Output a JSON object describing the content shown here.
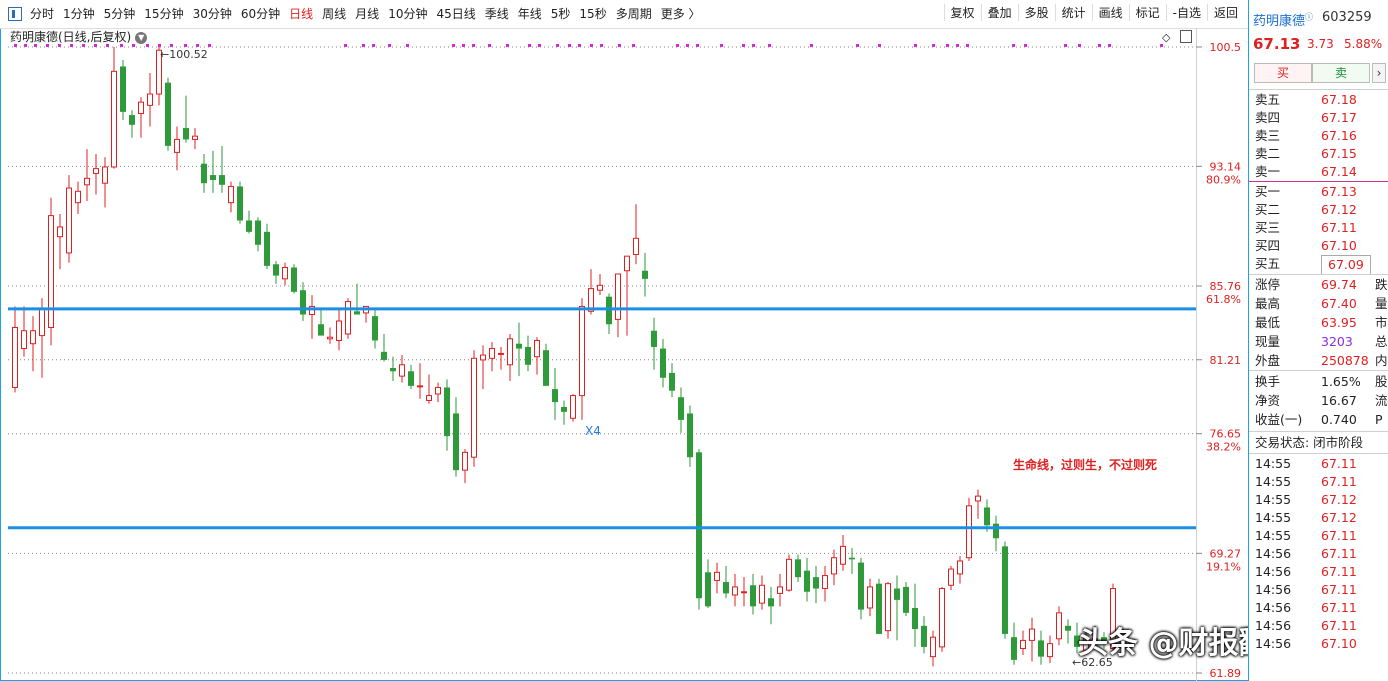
{
  "toolbar": {
    "periods": [
      "分时",
      "1分钟",
      "5分钟",
      "15分钟",
      "30分钟",
      "60分钟",
      "日线",
      "周线",
      "月线",
      "10分钟",
      "45日线",
      "季线",
      "年线",
      "5秒",
      "15秒",
      "多周期",
      "更多 〉"
    ],
    "active_period": "日线",
    "tools": [
      "复权",
      "叠加",
      "多股",
      "统计",
      "画线",
      "标记",
      "-自选",
      "返回"
    ]
  },
  "chart": {
    "title": "药明康德(日线,后复权)",
    "high_label": "100.52",
    "low_label": "62.65",
    "annotation": "生命线，过则生，不过则死",
    "marker_x4": "X4",
    "price_axis": [
      {
        "price": 100.5,
        "label": "100.5",
        "pct": ""
      },
      {
        "price": 93.14,
        "label": "93.14",
        "pct": "80.9%"
      },
      {
        "price": 85.76,
        "label": "85.76",
        "pct": "61.8%"
      },
      {
        "price": 81.21,
        "label": "81.21",
        "pct": ""
      },
      {
        "price": 76.65,
        "label": "76.65",
        "pct": "38.2%"
      },
      {
        "price": 69.27,
        "label": "69.27",
        "pct": "19.1%"
      },
      {
        "price": 61.89,
        "label": "61.89",
        "pct": ""
      }
    ],
    "support_lines": [
      84.35,
      70.85
    ],
    "colors": {
      "up": "#e02020",
      "down": "#2e9a3a",
      "line": "#1a8fe3",
      "dots": "#e020e0"
    }
  },
  "watermark": "头条 @财报翻译官",
  "quote": {
    "name": "药明康德",
    "code": "603259",
    "price": "67.13",
    "change": "3.73",
    "pct": "5.88%",
    "buy": "买",
    "sell": "卖",
    "asks": [
      {
        "label": "卖五",
        "price": "67.18"
      },
      {
        "label": "卖四",
        "price": "67.17"
      },
      {
        "label": "卖三",
        "price": "67.16"
      },
      {
        "label": "卖二",
        "price": "67.15"
      },
      {
        "label": "卖一",
        "price": "67.14"
      }
    ],
    "bids": [
      {
        "label": "买一",
        "price": "67.13"
      },
      {
        "label": "买二",
        "price": "67.12"
      },
      {
        "label": "买三",
        "price": "67.11"
      },
      {
        "label": "买四",
        "price": "67.10"
      },
      {
        "label": "买五",
        "price": "67.09"
      }
    ],
    "stats1": [
      {
        "label": "涨停",
        "value": "69.74",
        "cls": "red",
        "right": "跌"
      },
      {
        "label": "最高",
        "value": "67.40",
        "cls": "red",
        "right": "量"
      },
      {
        "label": "最低",
        "value": "63.95",
        "cls": "red",
        "right": "市"
      },
      {
        "label": "现量",
        "value": "3203",
        "cls": "purple",
        "right": "总"
      },
      {
        "label": "外盘",
        "value": "250878",
        "cls": "red",
        "right": "内"
      }
    ],
    "stats2": [
      {
        "label": "换手",
        "value": "1.65%",
        "right": "股"
      },
      {
        "label": "净资",
        "value": "16.67",
        "right": "流"
      },
      {
        "label": "收益(一)",
        "value": "0.740",
        "right": "P"
      }
    ],
    "status_label": "交易状态: 闭市阶段",
    "ticks": [
      {
        "t": "14:55",
        "p": "67.11"
      },
      {
        "t": "14:55",
        "p": "67.11"
      },
      {
        "t": "14:55",
        "p": "67.12"
      },
      {
        "t": "14:55",
        "p": "67.12"
      },
      {
        "t": "14:55",
        "p": "67.11"
      },
      {
        "t": "14:56",
        "p": "67.11"
      },
      {
        "t": "14:56",
        "p": "67.11"
      },
      {
        "t": "14:56",
        "p": "67.11"
      },
      {
        "t": "14:56",
        "p": "67.11"
      },
      {
        "t": "14:56",
        "p": "67.11"
      },
      {
        "t": "14:56",
        "p": "67.10"
      }
    ]
  },
  "candles": [
    {
      "o": 79.5,
      "h": 84.5,
      "l": 79.2,
      "c": 83.2
    },
    {
      "o": 81.9,
      "h": 84.5,
      "l": 81.4,
      "c": 83.0
    },
    {
      "o": 82.2,
      "h": 83.9,
      "l": 80.5,
      "c": 83.0
    },
    {
      "o": 82.7,
      "h": 85.0,
      "l": 80.1,
      "c": 84.4
    },
    {
      "o": 83.2,
      "h": 91.2,
      "l": 82.1,
      "c": 90.1
    },
    {
      "o": 88.8,
      "h": 90.2,
      "l": 86.8,
      "c": 89.4
    },
    {
      "o": 87.8,
      "h": 92.6,
      "l": 87.2,
      "c": 91.8
    },
    {
      "o": 90.9,
      "h": 92.2,
      "l": 90.2,
      "c": 91.6
    },
    {
      "o": 92.0,
      "h": 94.2,
      "l": 91.0,
      "c": 92.4
    },
    {
      "o": 92.7,
      "h": 93.9,
      "l": 91.4,
      "c": 93.0
    },
    {
      "o": 92.1,
      "h": 93.7,
      "l": 90.6,
      "c": 93.1
    },
    {
      "o": 93.1,
      "h": 100.5,
      "l": 93.0,
      "c": 99.0
    },
    {
      "o": 99.3,
      "h": 99.7,
      "l": 96.0,
      "c": 96.5
    },
    {
      "o": 96.3,
      "h": 96.6,
      "l": 94.9,
      "c": 95.7
    },
    {
      "o": 96.4,
      "h": 97.4,
      "l": 94.9,
      "c": 97.1
    },
    {
      "o": 96.9,
      "h": 98.9,
      "l": 95.6,
      "c": 97.6
    },
    {
      "o": 97.6,
      "h": 100.5,
      "l": 96.9,
      "c": 100.3
    },
    {
      "o": 98.3,
      "h": 98.6,
      "l": 94.1,
      "c": 94.4
    },
    {
      "o": 94.0,
      "h": 95.6,
      "l": 92.9,
      "c": 94.8
    },
    {
      "o": 95.5,
      "h": 97.5,
      "l": 94.6,
      "c": 94.8
    },
    {
      "o": 94.8,
      "h": 95.5,
      "l": 94.2,
      "c": 95.0
    },
    {
      "o": 93.3,
      "h": 93.9,
      "l": 91.5,
      "c": 92.1
    },
    {
      "o": 92.6,
      "h": 94.1,
      "l": 91.5,
      "c": 92.3
    },
    {
      "o": 92.6,
      "h": 94.4,
      "l": 91.5,
      "c": 92.0
    },
    {
      "o": 90.9,
      "h": 92.2,
      "l": 90.3,
      "c": 91.9
    },
    {
      "o": 91.9,
      "h": 92.2,
      "l": 89.6,
      "c": 89.8
    },
    {
      "o": 89.8,
      "h": 90.4,
      "l": 89.0,
      "c": 89.1
    },
    {
      "o": 89.8,
      "h": 90.0,
      "l": 87.9,
      "c": 88.3
    },
    {
      "o": 89.1,
      "h": 89.6,
      "l": 86.8,
      "c": 87.0
    },
    {
      "o": 87.1,
      "h": 87.3,
      "l": 85.9,
      "c": 86.4
    },
    {
      "o": 86.2,
      "h": 87.2,
      "l": 85.8,
      "c": 86.9
    },
    {
      "o": 86.9,
      "h": 87.1,
      "l": 85.3,
      "c": 85.4
    },
    {
      "o": 85.5,
      "h": 86.0,
      "l": 83.6,
      "c": 84.0
    },
    {
      "o": 84.0,
      "h": 85.2,
      "l": 82.5,
      "c": 84.5
    },
    {
      "o": 83.4,
      "h": 84.4,
      "l": 82.9,
      "c": 82.7
    },
    {
      "o": 82.5,
      "h": 83.2,
      "l": 82.2,
      "c": 82.6
    },
    {
      "o": 82.4,
      "h": 84.3,
      "l": 81.8,
      "c": 83.6
    },
    {
      "o": 82.8,
      "h": 85.0,
      "l": 82.5,
      "c": 84.8
    },
    {
      "o": 84.2,
      "h": 85.9,
      "l": 84.0,
      "c": 84.0
    },
    {
      "o": 84.1,
      "h": 84.5,
      "l": 83.5,
      "c": 84.5
    },
    {
      "o": 83.9,
      "h": 84.3,
      "l": 81.9,
      "c": 82.4
    },
    {
      "o": 81.7,
      "h": 82.8,
      "l": 81.1,
      "c": 81.2
    },
    {
      "o": 80.7,
      "h": 81.4,
      "l": 79.9,
      "c": 80.5
    },
    {
      "o": 80.2,
      "h": 81.5,
      "l": 79.8,
      "c": 80.9
    },
    {
      "o": 80.5,
      "h": 80.9,
      "l": 79.4,
      "c": 79.6
    },
    {
      "o": 79.6,
      "h": 81.0,
      "l": 78.8,
      "c": 79.6
    },
    {
      "o": 78.7,
      "h": 80.3,
      "l": 78.5,
      "c": 79.0
    },
    {
      "o": 79.1,
      "h": 79.8,
      "l": 78.6,
      "c": 79.5
    },
    {
      "o": 79.5,
      "h": 80.0,
      "l": 75.6,
      "c": 76.5
    },
    {
      "o": 77.9,
      "h": 78.9,
      "l": 74.0,
      "c": 74.4
    },
    {
      "o": 74.4,
      "h": 75.7,
      "l": 73.6,
      "c": 75.5
    },
    {
      "o": 75.2,
      "h": 81.8,
      "l": 74.6,
      "c": 81.3
    },
    {
      "o": 81.2,
      "h": 82.1,
      "l": 79.4,
      "c": 81.5
    },
    {
      "o": 81.3,
      "h": 82.3,
      "l": 80.5,
      "c": 81.9
    },
    {
      "o": 81.6,
      "h": 82.0,
      "l": 80.6,
      "c": 81.6
    },
    {
      "o": 80.9,
      "h": 82.8,
      "l": 79.9,
      "c": 82.5
    },
    {
      "o": 82.2,
      "h": 83.5,
      "l": 80.2,
      "c": 81.9
    },
    {
      "o": 82.0,
      "h": 82.7,
      "l": 80.5,
      "c": 80.9
    },
    {
      "o": 81.4,
      "h": 82.6,
      "l": 80.3,
      "c": 82.4
    },
    {
      "o": 81.8,
      "h": 82.2,
      "l": 80.4,
      "c": 79.6
    },
    {
      "o": 79.4,
      "h": 80.7,
      "l": 77.5,
      "c": 78.6
    },
    {
      "o": 78.3,
      "h": 78.7,
      "l": 77.2,
      "c": 78.0
    },
    {
      "o": 77.6,
      "h": 79.1,
      "l": 77.4,
      "c": 79.0
    },
    {
      "o": 79.0,
      "h": 85.0,
      "l": 77.5,
      "c": 84.5
    },
    {
      "o": 84.2,
      "h": 86.8,
      "l": 84.0,
      "c": 85.6
    },
    {
      "o": 85.5,
      "h": 86.5,
      "l": 85.2,
      "c": 85.8
    },
    {
      "o": 85.1,
      "h": 85.3,
      "l": 82.8,
      "c": 83.4
    },
    {
      "o": 83.7,
      "h": 86.2,
      "l": 82.6,
      "c": 86.5
    },
    {
      "o": 86.7,
      "h": 87.2,
      "l": 82.7,
      "c": 87.6
    },
    {
      "o": 87.7,
      "h": 90.8,
      "l": 87.1,
      "c": 88.7
    },
    {
      "o": 86.7,
      "h": 87.8,
      "l": 85.1,
      "c": 86.2
    },
    {
      "o": 83.0,
      "h": 83.8,
      "l": 80.6,
      "c": 82.0
    },
    {
      "o": 81.9,
      "h": 82.5,
      "l": 79.5,
      "c": 80.1
    },
    {
      "o": 80.4,
      "h": 81.0,
      "l": 78.9,
      "c": 79.3
    },
    {
      "o": 78.9,
      "h": 79.5,
      "l": 76.7,
      "c": 77.5
    },
    {
      "o": 77.9,
      "h": 78.4,
      "l": 74.6,
      "c": 75.2
    },
    {
      "o": 75.5,
      "h": 75.7,
      "l": 65.8,
      "c": 66.5
    },
    {
      "o": 68.1,
      "h": 68.9,
      "l": 65.9,
      "c": 66.0
    },
    {
      "o": 67.6,
      "h": 68.7,
      "l": 66.8,
      "c": 68.1
    },
    {
      "o": 67.5,
      "h": 68.5,
      "l": 66.5,
      "c": 66.8
    },
    {
      "o": 66.7,
      "h": 68.0,
      "l": 66.0,
      "c": 67.2
    },
    {
      "o": 66.9,
      "h": 67.8,
      "l": 66.0,
      "c": 66.9
    },
    {
      "o": 67.3,
      "h": 68.0,
      "l": 65.5,
      "c": 66.0
    },
    {
      "o": 66.2,
      "h": 67.9,
      "l": 65.8,
      "c": 67.3
    },
    {
      "o": 66.5,
      "h": 67.2,
      "l": 64.9,
      "c": 66.0
    },
    {
      "o": 66.8,
      "h": 68.0,
      "l": 66.0,
      "c": 67.2
    },
    {
      "o": 67.0,
      "h": 69.2,
      "l": 66.9,
      "c": 68.9
    },
    {
      "o": 68.9,
      "h": 69.2,
      "l": 67.5,
      "c": 67.8
    },
    {
      "o": 68.2,
      "h": 69.0,
      "l": 66.3,
      "c": 66.9
    },
    {
      "o": 67.8,
      "h": 68.5,
      "l": 66.2,
      "c": 67.1
    },
    {
      "o": 67.1,
      "h": 68.5,
      "l": 66.3,
      "c": 67.9
    },
    {
      "o": 68.0,
      "h": 69.5,
      "l": 67.3,
      "c": 69.0
    },
    {
      "o": 68.6,
      "h": 70.4,
      "l": 68.2,
      "c": 69.7
    },
    {
      "o": 69.0,
      "h": 69.6,
      "l": 68.0,
      "c": 68.9
    },
    {
      "o": 68.7,
      "h": 69.0,
      "l": 65.2,
      "c": 65.8
    },
    {
      "o": 65.9,
      "h": 67.7,
      "l": 65.4,
      "c": 67.2
    },
    {
      "o": 67.4,
      "h": 67.7,
      "l": 64.3,
      "c": 64.3
    },
    {
      "o": 64.5,
      "h": 67.5,
      "l": 64.0,
      "c": 67.4
    },
    {
      "o": 67.1,
      "h": 67.9,
      "l": 63.9,
      "c": 66.4
    },
    {
      "o": 67.2,
      "h": 67.5,
      "l": 65.4,
      "c": 65.6
    },
    {
      "o": 65.9,
      "h": 67.4,
      "l": 63.5,
      "c": 64.6
    },
    {
      "o": 64.8,
      "h": 65.4,
      "l": 63.1,
      "c": 63.5
    },
    {
      "o": 62.9,
      "h": 64.5,
      "l": 62.3,
      "c": 64.1
    },
    {
      "o": 63.5,
      "h": 67.2,
      "l": 63.2,
      "c": 67.1
    },
    {
      "o": 67.3,
      "h": 68.5,
      "l": 67.0,
      "c": 68.3
    },
    {
      "o": 68.0,
      "h": 69.1,
      "l": 67.4,
      "c": 68.8
    },
    {
      "o": 69.0,
      "h": 72.7,
      "l": 68.8,
      "c": 72.2
    },
    {
      "o": 72.5,
      "h": 73.2,
      "l": 71.4,
      "c": 72.8
    },
    {
      "o": 72.1,
      "h": 72.6,
      "l": 70.6,
      "c": 71.0
    },
    {
      "o": 71.1,
      "h": 71.6,
      "l": 69.4,
      "c": 70.2
    },
    {
      "o": 69.7,
      "h": 70.0,
      "l": 64.0,
      "c": 64.3
    },
    {
      "o": 64.1,
      "h": 65.0,
      "l": 62.4,
      "c": 62.7
    },
    {
      "o": 63.4,
      "h": 64.5,
      "l": 63.0,
      "c": 63.9
    },
    {
      "o": 63.9,
      "h": 65.3,
      "l": 62.6,
      "c": 64.6
    },
    {
      "o": 63.9,
      "h": 64.5,
      "l": 62.4,
      "c": 62.9
    },
    {
      "o": 62.9,
      "h": 64.2,
      "l": 62.5,
      "c": 63.7
    },
    {
      "o": 64.0,
      "h": 66.0,
      "l": 63.6,
      "c": 65.6
    },
    {
      "o": 64.8,
      "h": 65.2,
      "l": 63.7,
      "c": 64.5
    },
    {
      "o": 64.2,
      "h": 65.0,
      "l": 63.1,
      "c": 63.5
    },
    {
      "o": 63.3,
      "h": 64.4,
      "l": 63.0,
      "c": 64.1
    },
    {
      "o": 64.0,
      "h": 64.8,
      "l": 63.4,
      "c": 64.0
    },
    {
      "o": 64.1,
      "h": 64.4,
      "l": 63.4,
      "c": 63.7
    },
    {
      "o": 63.4,
      "h": 67.4,
      "l": 63.2,
      "c": 67.1
    }
  ]
}
